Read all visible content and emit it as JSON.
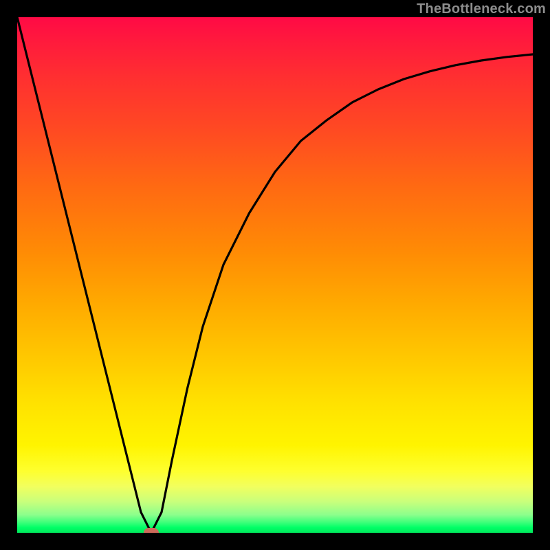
{
  "watermark": "TheBottleneck.com",
  "chart_data": {
    "type": "line",
    "title": "",
    "xlabel": "",
    "ylabel": "",
    "xlim": [
      0,
      100
    ],
    "ylim": [
      0,
      100
    ],
    "grid": false,
    "legend": false,
    "series": [
      {
        "name": "bottleneck-curve",
        "x": [
          0,
          5,
          10,
          15,
          20,
          24,
          26,
          28,
          30,
          33,
          36,
          40,
          45,
          50,
          55,
          60,
          65,
          70,
          75,
          80,
          85,
          90,
          95,
          100
        ],
        "y": [
          100,
          80,
          60,
          40,
          20,
          4,
          0,
          4,
          14,
          28,
          40,
          52,
          62,
          70,
          76,
          80,
          83.5,
          86,
          88,
          89.5,
          90.7,
          91.6,
          92.3,
          92.8
        ]
      }
    ],
    "marker": {
      "x": 26,
      "y": 0,
      "color": "#cc6a5a"
    },
    "background_gradient": {
      "top": "#ff0a45",
      "mid": "#ffe200",
      "bottom": "#00e85c"
    }
  }
}
